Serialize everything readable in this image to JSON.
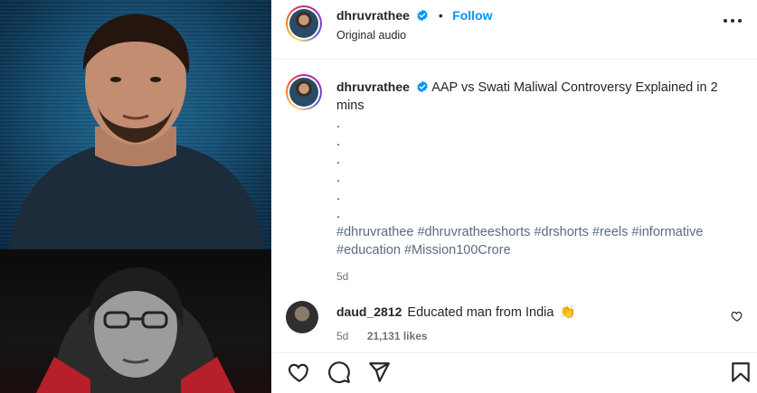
{
  "post": {
    "username": "dhruvrathee",
    "dot": "•",
    "follow_label": "Follow",
    "audio": "Original audio"
  },
  "caption": {
    "username": "dhruvrathee",
    "text": "AAP vs Swati Maliwal Controversy Explained in 2 mins",
    "dots": [
      ".",
      ".",
      ".",
      ".",
      ".",
      "."
    ],
    "hashtags": "#dhruvrathee #dhruvratheeshorts #drshorts #reels #informative #education #Mission100Crore",
    "time": "5d"
  },
  "comment": {
    "username": "daud_2812",
    "text": "Educated man from India",
    "emoji": "👏",
    "time": "5d",
    "likes": "21,131 likes"
  },
  "icons": {
    "like": "heart-icon",
    "comment": "comment-icon",
    "share": "share-icon",
    "save": "bookmark-icon",
    "more": "more-icon",
    "verified": "verified-badge-icon"
  },
  "colors": {
    "accent": "#0095f6",
    "hashtag": "#5b6b80",
    "muted": "#737373"
  }
}
